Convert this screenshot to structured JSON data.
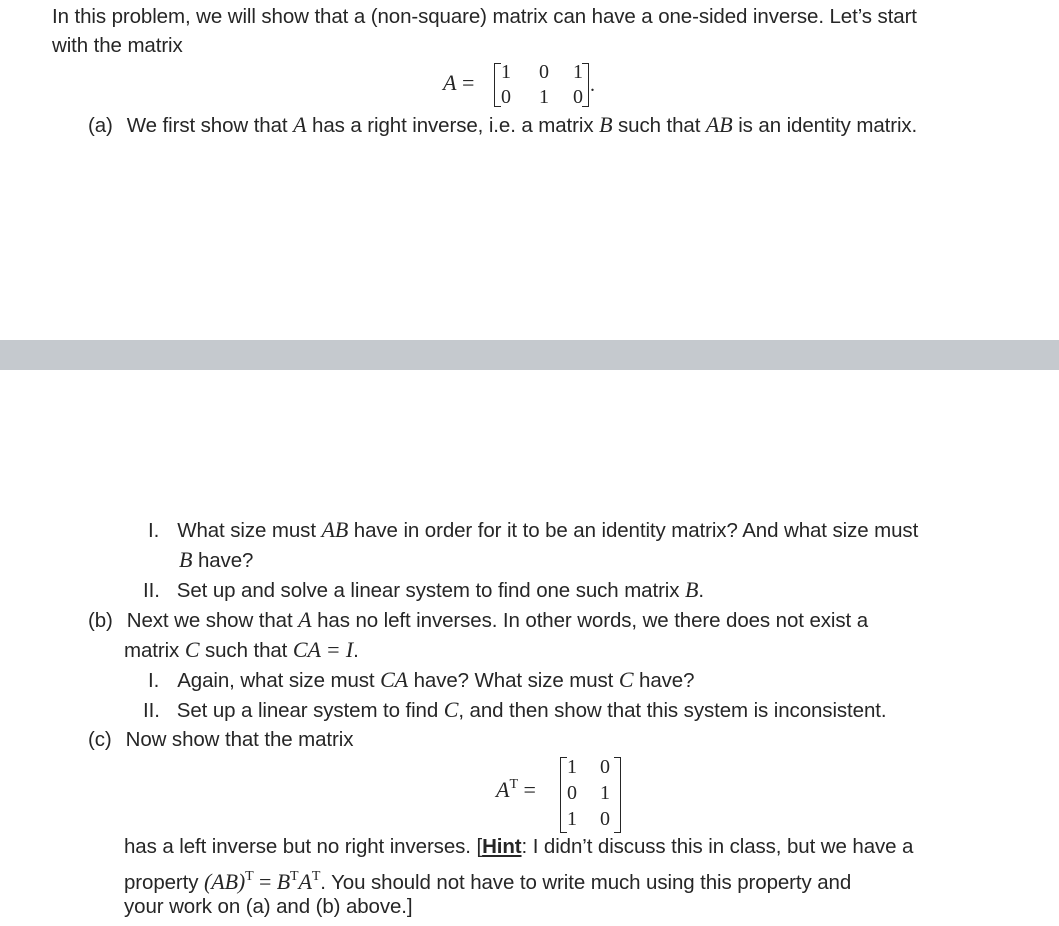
{
  "intro": {
    "line1": "In this problem, we will show that a (non-square) matrix can have a one-sided inverse. Let’s start",
    "line2": "with the matrix"
  },
  "matrix_A": {
    "lhs": "A",
    "eq": " =",
    "rows": [
      [
        "1",
        "0",
        "1"
      ],
      [
        "0",
        "1",
        "0"
      ]
    ],
    "trailing": "."
  },
  "part_a": {
    "label": "(a)",
    "text_1": "We first show that ",
    "var_A": "A",
    "text_2": " has a right inverse, i.e. a matrix ",
    "var_B": "B",
    "text_3": " such that ",
    "var_AB": "AB",
    "text_4": " is an identity matrix.",
    "sub": [
      {
        "numeral": "I.",
        "line1_a": "What size must ",
        "line1_var": "AB",
        "line1_b": " have in order for it to be an identity matrix? And what size must",
        "line2_var": "B",
        "line2_b": " have?"
      },
      {
        "numeral": "II.",
        "text_a": "Set up and solve a linear system to find one such matrix ",
        "var": "B",
        "text_b": "."
      }
    ]
  },
  "part_b": {
    "label": "(b)",
    "line1_a": "Next we show that ",
    "line1_var": "A",
    "line1_b": " has no left inverses. In other words, we there does not exist a",
    "line2_a": "matrix ",
    "line2_var": "C",
    "line2_b": " such that ",
    "line2_eq": "CA = I",
    "line2_c": ".",
    "sub": [
      {
        "numeral": "I.",
        "text_a": "Again, what size must ",
        "var1": "CA",
        "text_b": " have? What size must ",
        "var2": "C",
        "text_c": " have?"
      },
      {
        "numeral": "II.",
        "text_a": "Set up a linear system to find ",
        "var": "C",
        "text_b": ", and then show that this system is inconsistent."
      }
    ]
  },
  "part_c": {
    "label": "(c)",
    "line1": "Now show that the matrix",
    "matrix": {
      "lhs": "A",
      "sup": "T",
      "eq": " =",
      "rows": [
        [
          "1",
          "0"
        ],
        [
          "0",
          "1"
        ],
        [
          "1",
          "0"
        ]
      ]
    },
    "line2_a": "has a left inverse but no right inverses. [",
    "hint_label": "Hint",
    "line2_b": ": I didn’t discuss this in class, but we have a",
    "line3_a": "property ",
    "line3_expr_1": "(AB)",
    "line3_sup1": "T",
    "line3_eq": " = ",
    "line3_expr_2": "B",
    "line3_sup2": "T",
    "line3_expr_3": "A",
    "line3_sup3": "T",
    "line3_b": ". You should not have to write much using this property and",
    "line4": "your work on (a) and (b) above.]"
  },
  "colors": {
    "text": "#262626",
    "separator_bar": "#c5c9ce",
    "background": "#ffffff"
  }
}
